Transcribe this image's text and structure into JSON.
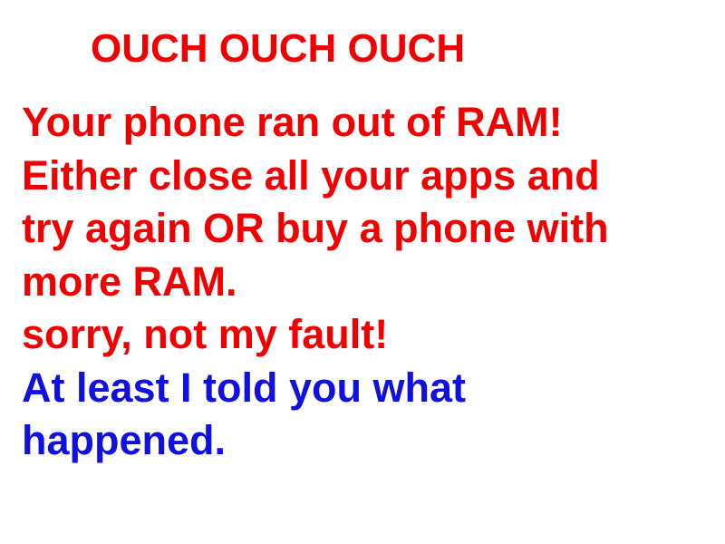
{
  "title": {
    "text": "OUCH OUCH OUCH",
    "color": "#f00000"
  },
  "message": {
    "color": "#f00000",
    "lines": [
      "Your phone ran out of RAM!",
      "Either close all your apps and",
      "try again OR buy a phone with",
      "more RAM.",
      "sorry, not my fault!"
    ]
  },
  "footer": {
    "color": "#1010e0",
    "lines": [
      "At least I told you what",
      "happened."
    ]
  }
}
